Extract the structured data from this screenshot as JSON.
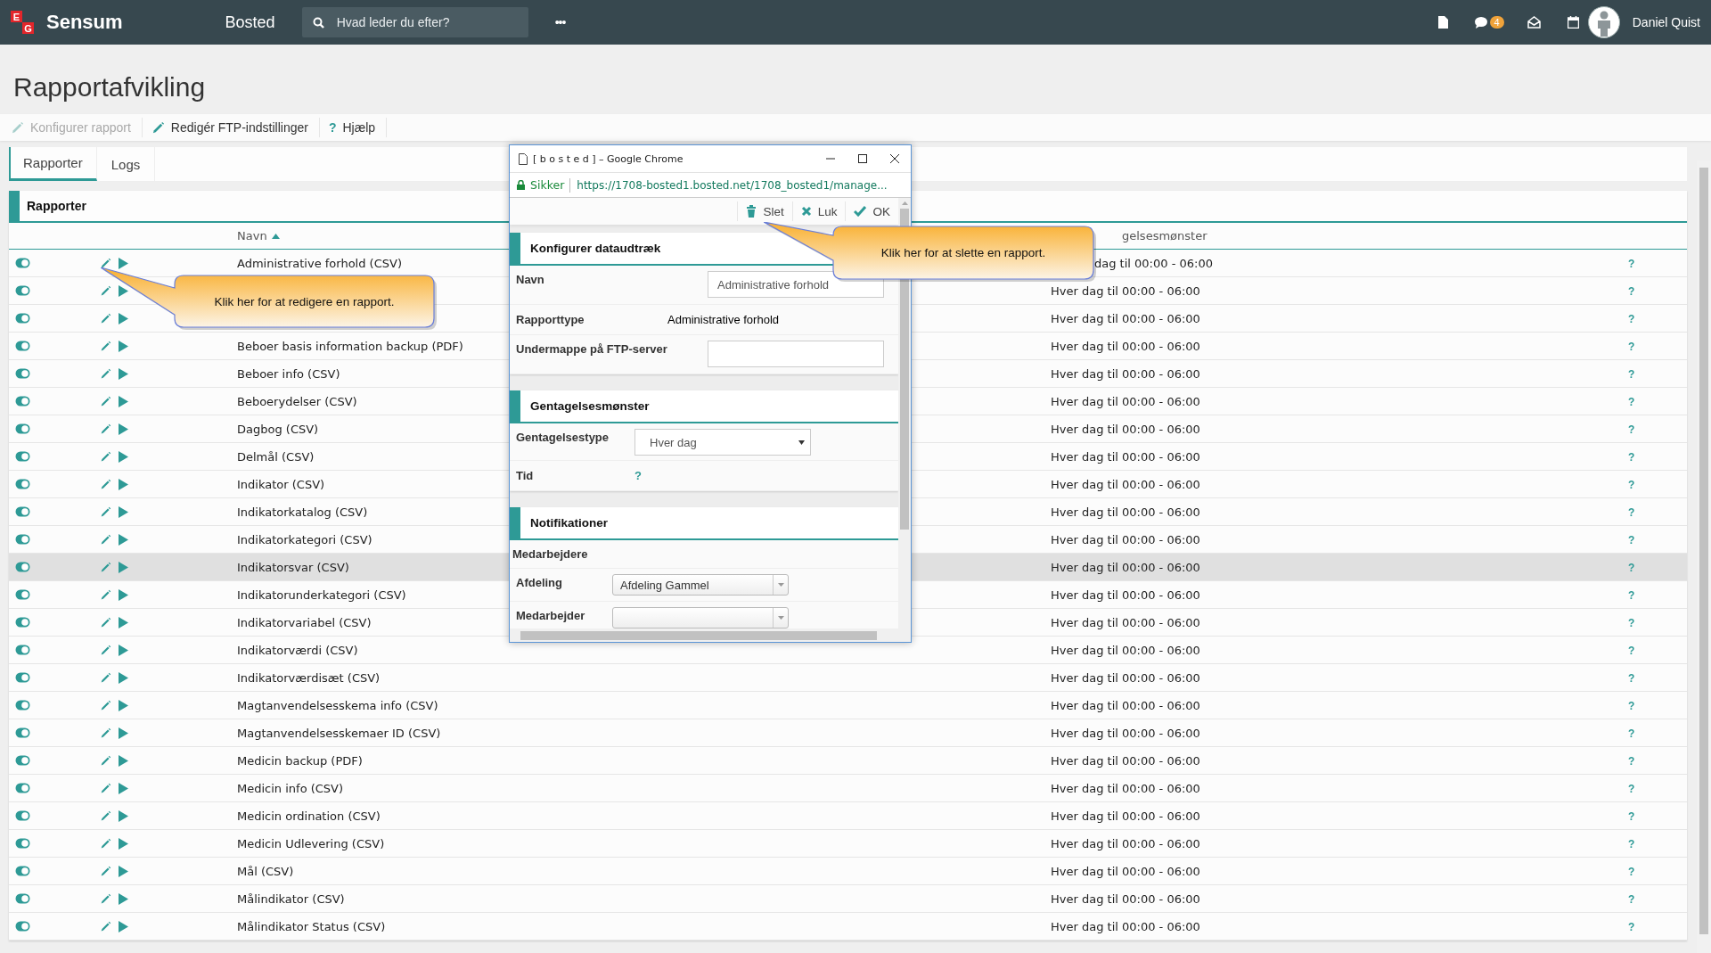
{
  "topbar": {
    "logo_letters": [
      "E",
      "G"
    ],
    "app_name": "Sensum",
    "module": "Bosted",
    "search": {
      "placeholder": "Hvad leder du efter?"
    },
    "more": "•••",
    "chat_badge": "4",
    "user": "Daniel Quist"
  },
  "page": {
    "title": "Rapportafvikling"
  },
  "toolbar": [
    {
      "kind": "pencil",
      "label": "Konfigurer rapport",
      "disabled": true
    },
    {
      "kind": "pencil",
      "label": "Redigér FTP-indstillinger",
      "disabled": false
    },
    {
      "kind": "help",
      "label": "Hjælp",
      "glyph": "?",
      "disabled": false
    }
  ],
  "tabs": [
    {
      "label": "Rapporter",
      "selected": true
    },
    {
      "label": "Logs",
      "selected": false
    }
  ],
  "panel": {
    "title": "Rapporter"
  },
  "table": {
    "columns": [
      {
        "label": "Navn",
        "sorted": true
      },
      {
        "label": "gelsesmønster",
        "sorted": false
      }
    ],
    "rows": [
      {
        "enabled": true,
        "name": "Administrative forhold (CSV)",
        "schedule": "dag til 00:00 - 06:00",
        "help": "?",
        "selected": false
      },
      {
        "enabled": true,
        "schedule": "Hver dag til 00:00 - 06:00",
        "help": "?",
        "selected": false
      },
      {
        "enabled": true,
        "schedule": "Hver dag til 00:00 - 06:00",
        "help": "?",
        "selected": false
      },
      {
        "enabled": true,
        "name": "Beboer basis information backup (PDF)",
        "schedule": "Hver dag til 00:00 - 06:00",
        "help": "?",
        "selected": false
      },
      {
        "enabled": true,
        "name": "Beboer info (CSV)",
        "schedule": "Hver dag til 00:00 - 06:00",
        "help": "?",
        "selected": false
      },
      {
        "enabled": true,
        "name": "Beboerydelser (CSV)",
        "schedule": "Hver dag til 00:00 - 06:00",
        "help": "?",
        "selected": false
      },
      {
        "enabled": true,
        "name": "Dagbog (CSV)",
        "schedule": "Hver dag til 00:00 - 06:00",
        "help": "?",
        "selected": false
      },
      {
        "enabled": true,
        "name": "Delmål (CSV)",
        "schedule": "Hver dag til 00:00 - 06:00",
        "help": "?",
        "selected": false
      },
      {
        "enabled": true,
        "name": "Indikator (CSV)",
        "schedule": "Hver dag til 00:00 - 06:00",
        "help": "?",
        "selected": false
      },
      {
        "enabled": true,
        "name": "Indikatorkatalog (CSV)",
        "schedule": "Hver dag til 00:00 - 06:00",
        "help": "?",
        "selected": false
      },
      {
        "enabled": true,
        "name": "Indikatorkategori (CSV)",
        "schedule": "Hver dag til 00:00 - 06:00",
        "help": "?",
        "selected": false
      },
      {
        "enabled": true,
        "name": "Indikatorsvar (CSV)",
        "schedule": "Hver dag til 00:00 - 06:00",
        "help": "?",
        "selected": true
      },
      {
        "enabled": true,
        "name": "Indikatorunderkategori (CSV)",
        "schedule": "Hver dag til 00:00 - 06:00",
        "help": "?",
        "selected": false
      },
      {
        "enabled": true,
        "name": "Indikatorvariabel (CSV)",
        "schedule": "Hver dag til 00:00 - 06:00",
        "help": "?",
        "selected": false
      },
      {
        "enabled": true,
        "name": "Indikatorværdi (CSV)",
        "schedule": "Hver dag til 00:00 - 06:00",
        "help": "?",
        "selected": false
      },
      {
        "enabled": true,
        "name": "Indikatorværdisæt (CSV)",
        "schedule": "Hver dag til 00:00 - 06:00",
        "help": "?",
        "selected": false
      },
      {
        "enabled": true,
        "name": "Magtanvendelsesskema info (CSV)",
        "schedule": "Hver dag til 00:00 - 06:00",
        "help": "?",
        "selected": false
      },
      {
        "enabled": true,
        "name": "Magtanvendelsesskemaer ID (CSV)",
        "schedule": "Hver dag til 00:00 - 06:00",
        "help": "?",
        "selected": false
      },
      {
        "enabled": true,
        "name": "Medicin backup (PDF)",
        "schedule": "Hver dag til 00:00 - 06:00",
        "help": "?",
        "selected": false
      },
      {
        "enabled": true,
        "name": "Medicin info (CSV)",
        "schedule": "Hver dag til 00:00 - 06:00",
        "help": "?",
        "selected": false
      },
      {
        "enabled": true,
        "name": "Medicin ordination (CSV)",
        "schedule": "Hver dag til 00:00 - 06:00",
        "help": "?",
        "selected": false
      },
      {
        "enabled": true,
        "name": "Medicin Udlevering (CSV)",
        "schedule": "Hver dag til 00:00 - 06:00",
        "help": "?",
        "selected": false
      },
      {
        "enabled": true,
        "name": "Mål (CSV)",
        "schedule": "Hver dag til 00:00 - 06:00",
        "help": "?",
        "selected": false
      },
      {
        "enabled": true,
        "name": "Målindikator (CSV)",
        "schedule": "Hver dag til 00:00 - 06:00",
        "help": "?",
        "selected": false
      },
      {
        "enabled": true,
        "name": "Målindikator Status (CSV)",
        "schedule": "Hver dag til 00:00 - 06:00",
        "help": "?",
        "selected": false
      }
    ]
  },
  "popup": {
    "title": "[ b o s t e d ] – Google Chrome",
    "secure_label": "Sikker",
    "url": "https://1708-bosted1.bosted.net/1708_bosted1/manage...",
    "actions": [
      {
        "kind": "delete",
        "label": "Slet"
      },
      {
        "kind": "close",
        "label": "Luk"
      },
      {
        "kind": "ok",
        "label": "OK"
      }
    ],
    "sections": [
      {
        "title": "Konfigurer dataudtræk",
        "fields": [
          {
            "kind": "input",
            "label": "Navn",
            "value": "Administrative forhold"
          },
          {
            "kind": "text",
            "label": "Rapporttype",
            "value": "Administrative forhold"
          },
          {
            "kind": "input",
            "label": "Undermappe på FTP-server"
          }
        ]
      },
      {
        "title": "Gentagelsesmønster",
        "fields": [
          {
            "kind": "select",
            "label": "Gentagelsestype",
            "value": "Hver dag"
          },
          {
            "kind": "help",
            "label": "Tid",
            "value": "?"
          }
        ]
      },
      {
        "title": "Notifikationer",
        "subtitle": "Medarbejdere",
        "fields": [
          {
            "kind": "combo",
            "label": "Afdeling",
            "value": "Afdeling Gammel"
          },
          {
            "kind": "combo",
            "label": "Medarbejder"
          }
        ]
      }
    ]
  },
  "callouts": [
    {
      "text": "Klik her for at redigere en rapport."
    },
    {
      "text": "Klik her for at slette en rapport."
    }
  ]
}
